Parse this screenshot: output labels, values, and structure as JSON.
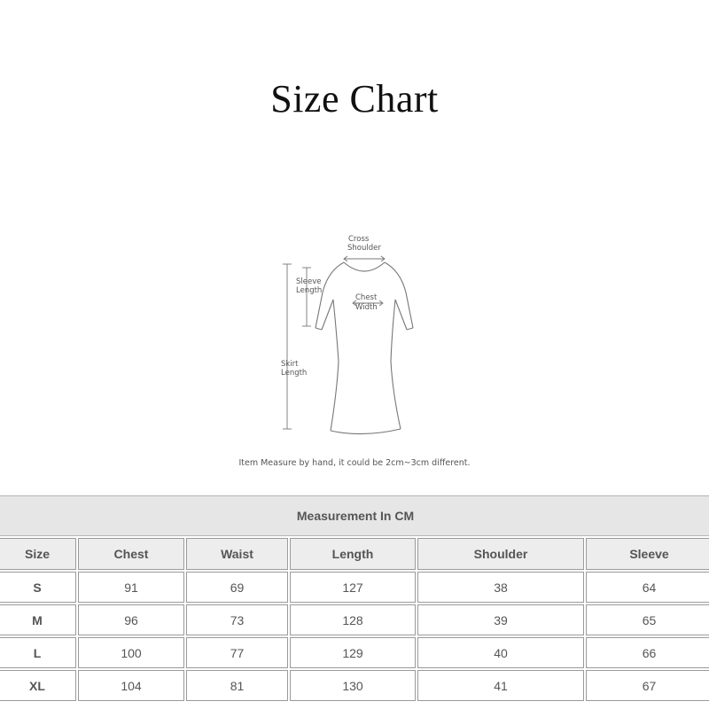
{
  "title": "Size Chart",
  "diagram": {
    "labels": {
      "cross_shoulder_1": "Cross",
      "cross_shoulder_2": "Shoulder",
      "sleeve_length_1": "Sleeve",
      "sleeve_length_2": "Length",
      "chest_width_1": "Chest",
      "chest_width_2": "Width",
      "skirt_length_1": "Skirt",
      "skirt_length_2": "Length"
    }
  },
  "note": "Item Measure by hand, it could be 2cm~3cm different.",
  "table": {
    "caption": "Measurement In CM",
    "headers": [
      "Size",
      "Chest",
      "Waist",
      "Length",
      "Shoulder",
      "Sleeve"
    ],
    "rows": [
      [
        "S",
        "91",
        "69",
        "127",
        "38",
        "64"
      ],
      [
        "M",
        "96",
        "73",
        "128",
        "39",
        "65"
      ],
      [
        "L",
        "100",
        "77",
        "129",
        "40",
        "66"
      ],
      [
        "XL",
        "104",
        "81",
        "130",
        "41",
        "67"
      ]
    ]
  }
}
